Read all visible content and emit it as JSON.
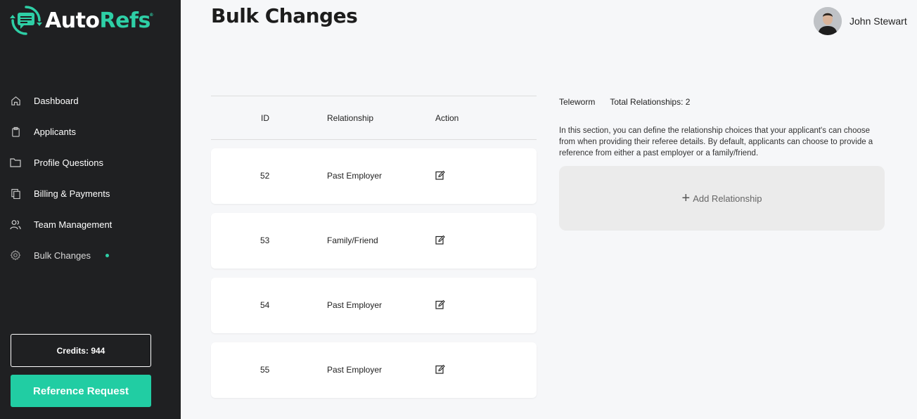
{
  "app": {
    "logo_auto": "Auto",
    "logo_refs": "Refs",
    "logo_mark": "®"
  },
  "sidebar": {
    "items": [
      {
        "label": "Dashboard",
        "icon": "home-icon"
      },
      {
        "label": "Applicants",
        "icon": "clipboard-icon"
      },
      {
        "label": "Profile Questions",
        "icon": "folder-icon"
      },
      {
        "label": "Billing & Payments",
        "icon": "copy-icon"
      },
      {
        "label": "Team Management",
        "icon": "users-icon"
      },
      {
        "label": "Bulk Changes",
        "icon": "gear-icon"
      }
    ],
    "credits": "Credits: 944",
    "reference_request": "Reference Request"
  },
  "header": {
    "title": "Bulk Changes",
    "user_name": "John Stewart"
  },
  "table": {
    "columns": [
      "ID",
      "Relationship",
      "Action"
    ],
    "rows": [
      {
        "id": "52",
        "relationship": "Past Employer"
      },
      {
        "id": "53",
        "relationship": "Family/Friend"
      },
      {
        "id": "54",
        "relationship": "Past Employer"
      },
      {
        "id": "55",
        "relationship": "Past Employer"
      }
    ]
  },
  "panel": {
    "company": "Teleworm",
    "total_relationships": "Total Relationships: 2",
    "description": "In this section, you can define the relationship choices that your applicant's can choose from when providing their referee details. By default, applicants can choose to provide a reference from either a past employer or a family/friend.",
    "add_label": "Add Relationship",
    "add_icon": "+"
  },
  "colors": {
    "sidebar_bg": "#1f2022",
    "accent": "#21cda3",
    "page_bg": "#f6f7f9"
  }
}
